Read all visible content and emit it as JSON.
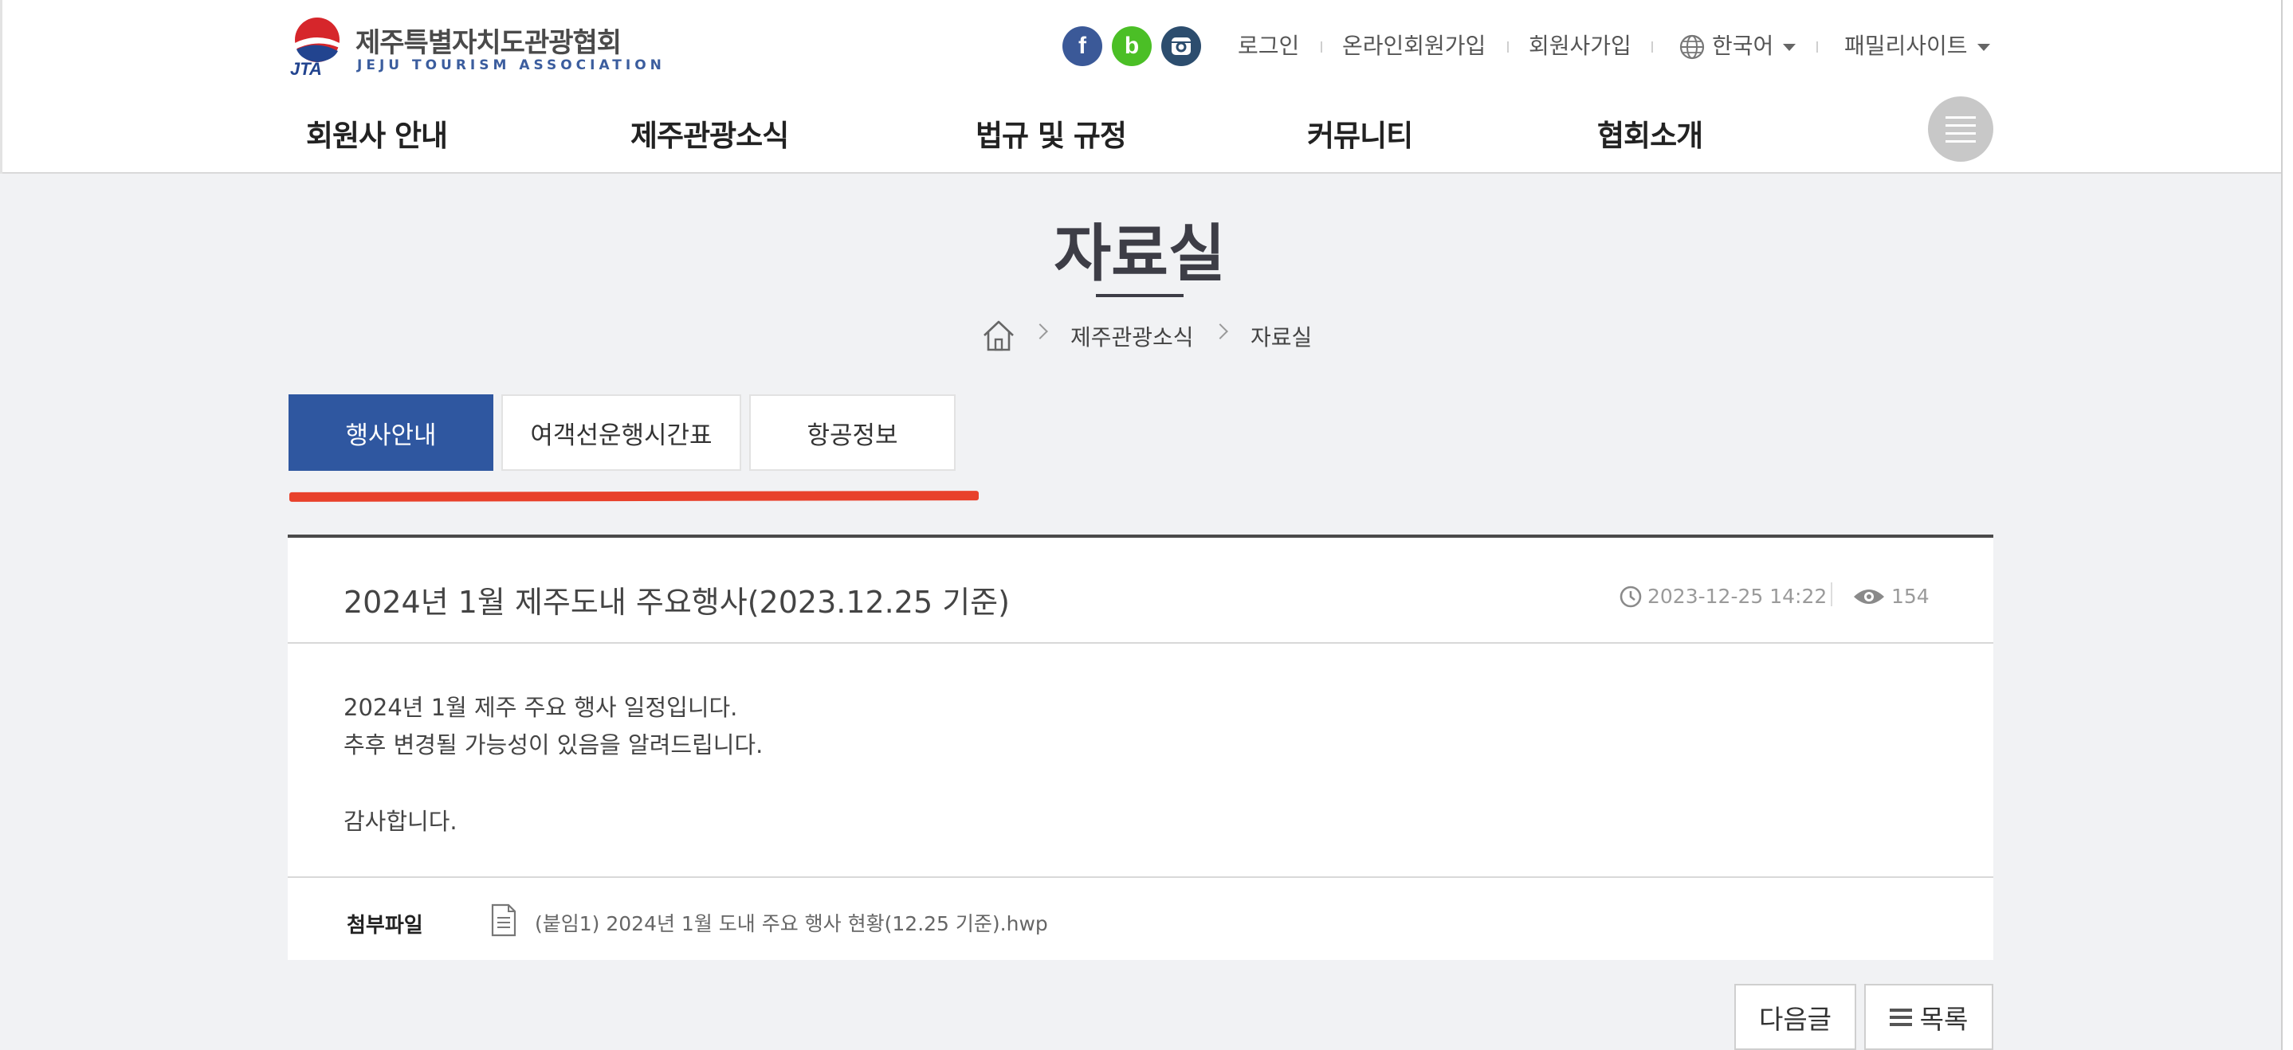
{
  "logo": {
    "name_ko": "제주특별자치도관광협회",
    "name_en": "JEJU TOURISM ASSOCIATION",
    "abbr": "JTA"
  },
  "social": [
    {
      "icon": "facebook-icon",
      "glyph": "f",
      "color": "#3b5998"
    },
    {
      "icon": "blog-icon",
      "glyph": "b",
      "color": "#4bbf26"
    },
    {
      "icon": "instagram-icon",
      "glyph": "",
      "color": "#2c4d6e"
    }
  ],
  "util": {
    "login": "로그인",
    "online_join": "온라인회원가입",
    "member_join": "회원사가입",
    "language": "한국어",
    "family_site": "패밀리사이트"
  },
  "gnb": [
    "회원사 안내",
    "제주관광소식",
    "법규 및 규정",
    "커뮤니티",
    "협회소개"
  ],
  "page": {
    "title": "자료실"
  },
  "breadcrumb": {
    "home_icon": "home-icon",
    "level1": "제주관광소식",
    "level2": "자료실"
  },
  "tabs": [
    {
      "label": "행사안내",
      "active": true
    },
    {
      "label": "여객선운행시간표",
      "active": false
    },
    {
      "label": "항공정보",
      "active": false
    }
  ],
  "article": {
    "title": "2024년 1월 제주도내 주요행사(2023.12.25 기준)",
    "date": "2023-12-25 14:22",
    "views": "154",
    "body": [
      "2024년 1월 제주 주요 행사 일정입니다.",
      "추후 변경될 가능성이 있음을 알려드립니다.",
      "",
      "감사합니다."
    ],
    "attachment_label": "첨부파일",
    "attachment_file": "(붙임1) 2024년 1월 도내 주요 행사 현황(12.25 기준).hwp"
  },
  "buttons": {
    "next": "다음글",
    "list": "목록"
  },
  "colors": {
    "accent": "#2f57a0",
    "highlight": "#e8412b"
  }
}
